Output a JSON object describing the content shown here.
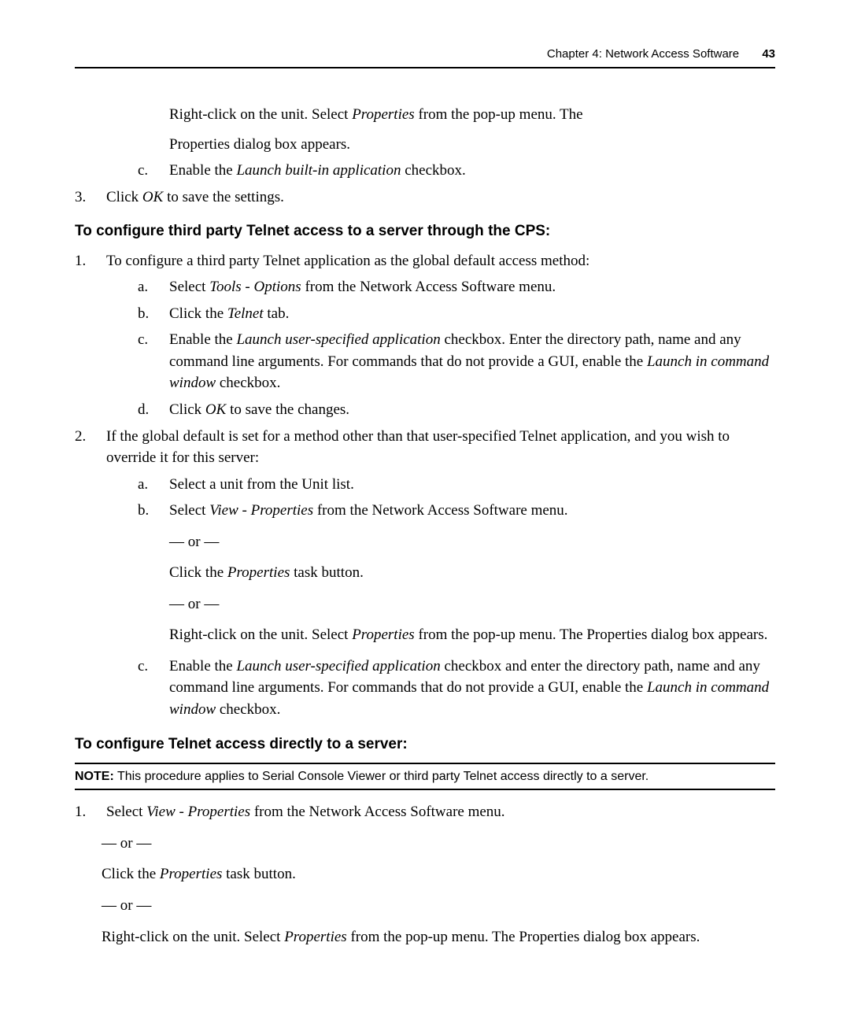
{
  "header": {
    "chapter": "Chapter 4: Network Access Software",
    "page": "43"
  },
  "intro_para_1": "Right-click on the unit. Select ",
  "intro_para_1_em": "Properties",
  "intro_para_1_tail": " from the pop-up menu. The",
  "intro_para_2": "Properties dialog box appears.",
  "intro_c_marker": "c.",
  "intro_c_text_a": "Enable the ",
  "intro_c_em": "Launch built-in application",
  "intro_c_text_b": " checkbox.",
  "intro_3_marker": "3.",
  "intro_3_text_a": "Click ",
  "intro_3_em": "OK",
  "intro_3_text_b": " to save the settings.",
  "heading1": "To configure third party Telnet access to a server through the CPS:",
  "s1_p1": {
    "marker": "1.",
    "text": "To configure a third party Telnet application as the global default access method:"
  },
  "s1_a": {
    "marker": "a.",
    "pre": "Select ",
    "em": "Tools - Options",
    "post": " from the Network Access Software menu."
  },
  "s1_b": {
    "marker": "b.",
    "pre": "Click the ",
    "em": "Telnet",
    "post": " tab."
  },
  "s1_c": {
    "marker": "c.",
    "pre": "Enable the ",
    "em1": "Launch user-specified application",
    "mid": " checkbox. Enter the directory path, name and any command line arguments. For commands that do not provide a GUI, enable the ",
    "em2": "Launch in command window",
    "post": " checkbox."
  },
  "s1_d": {
    "marker": "d.",
    "pre": "Click ",
    "em": "OK",
    "post": " to save the changes."
  },
  "s1_p2": {
    "marker": "2.",
    "text": "If the global default is set for a method other than that user-specified Telnet application, and you wish to override it for this server:"
  },
  "s2_a": {
    "marker": "a.",
    "text": "Select a unit from the Unit list."
  },
  "s2_b": {
    "marker": "b.",
    "pre": "Select ",
    "em": "View - Properties",
    "post": " from the Network Access Software menu."
  },
  "or_text": "— or —",
  "s2_b_alt1_pre": "Click the ",
  "s2_b_alt1_em": "Properties",
  "s2_b_alt1_post": " task button.",
  "s2_b_alt2_pre": "Right-click on the unit. Select ",
  "s2_b_alt2_em": "Properties",
  "s2_b_alt2_post": " from the pop-up menu. The Properties dialog box appears.",
  "s2_c": {
    "marker": "c.",
    "pre": "Enable the ",
    "em1": "Launch user-specified application",
    "mid": " checkbox and enter the directory path, name and any command line arguments. For commands that do not provide a GUI, enable the ",
    "em2": "Launch in command window",
    "post": " checkbox."
  },
  "heading2": "To configure Telnet access directly to a server:",
  "note_label": "NOTE:",
  "note_text": "  This procedure applies to Serial Console Viewer or third party Telnet access directly to a server.",
  "s3_p1": {
    "marker": "1.",
    "pre": "Select ",
    "em": "View - Properties",
    "post": " from the Network Access Software menu."
  },
  "s3_alt1_pre": "Click the ",
  "s3_alt1_em": "Properties",
  "s3_alt1_post": " task button.",
  "s3_alt2_pre": "Right-click on the unit. Select ",
  "s3_alt2_em": "Properties",
  "s3_alt2_post": " from the pop-up menu. The Properties dialog box appears."
}
